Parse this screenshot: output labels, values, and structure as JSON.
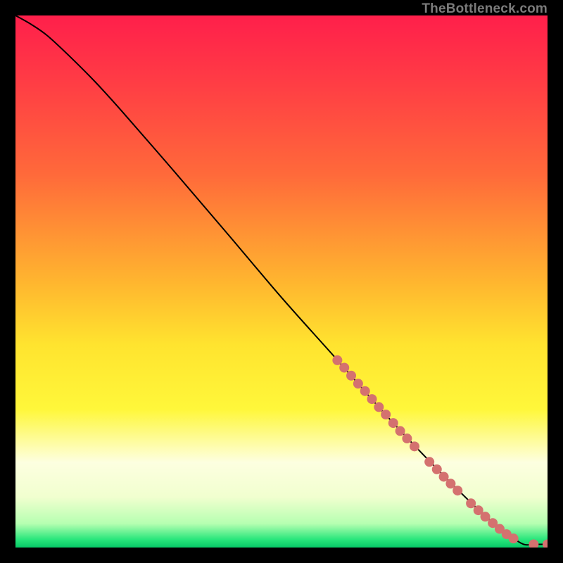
{
  "watermark": "TheBottleneck.com",
  "chart_data": {
    "type": "line",
    "title": "",
    "xlabel": "",
    "ylabel": "",
    "xlim": [
      0,
      100
    ],
    "ylim": [
      0,
      100
    ],
    "gradient_stops": [
      {
        "offset": 0.0,
        "color": "#ff1f4b"
      },
      {
        "offset": 0.12,
        "color": "#ff3b45"
      },
      {
        "offset": 0.3,
        "color": "#ff6a3a"
      },
      {
        "offset": 0.5,
        "color": "#ffb52f"
      },
      {
        "offset": 0.62,
        "color": "#ffe42f"
      },
      {
        "offset": 0.74,
        "color": "#fff73a"
      },
      {
        "offset": 0.84,
        "color": "#fdffe0"
      },
      {
        "offset": 0.905,
        "color": "#f1ffcf"
      },
      {
        "offset": 0.955,
        "color": "#b6ffb1"
      },
      {
        "offset": 0.985,
        "color": "#28e67b"
      },
      {
        "offset": 1.0,
        "color": "#07c867"
      }
    ],
    "series": [
      {
        "name": "curve",
        "points": [
          {
            "x": 0,
            "y": 100
          },
          {
            "x": 3,
            "y": 98.3
          },
          {
            "x": 6,
            "y": 96.2
          },
          {
            "x": 10,
            "y": 92.5
          },
          {
            "x": 15,
            "y": 87.5
          },
          {
            "x": 20,
            "y": 82.0
          },
          {
            "x": 30,
            "y": 70.5
          },
          {
            "x": 40,
            "y": 58.8
          },
          {
            "x": 50,
            "y": 47.0
          },
          {
            "x": 60,
            "y": 35.8
          },
          {
            "x": 70,
            "y": 24.5
          },
          {
            "x": 80,
            "y": 14.0
          },
          {
            "x": 88,
            "y": 6.2
          },
          {
            "x": 93,
            "y": 2.2
          },
          {
            "x": 95.5,
            "y": 0.6
          },
          {
            "x": 97.2,
            "y": 0.6
          },
          {
            "x": 100,
            "y": 0.6
          }
        ]
      }
    ],
    "scatter": {
      "name": "dots",
      "color": "#d4716f",
      "radius": 7,
      "points": [
        {
          "x": 60.5,
          "y": 35.2
        },
        {
          "x": 61.8,
          "y": 33.8
        },
        {
          "x": 63.1,
          "y": 32.3
        },
        {
          "x": 64.4,
          "y": 30.8
        },
        {
          "x": 65.7,
          "y": 29.4
        },
        {
          "x": 67.0,
          "y": 27.9
        },
        {
          "x": 68.3,
          "y": 26.4
        },
        {
          "x": 69.6,
          "y": 25.0
        },
        {
          "x": 71.0,
          "y": 23.4
        },
        {
          "x": 72.3,
          "y": 21.9
        },
        {
          "x": 73.6,
          "y": 20.5
        },
        {
          "x": 75.0,
          "y": 19.0
        },
        {
          "x": 77.8,
          "y": 16.1
        },
        {
          "x": 79.2,
          "y": 14.7
        },
        {
          "x": 80.5,
          "y": 13.3
        },
        {
          "x": 81.8,
          "y": 12.0
        },
        {
          "x": 83.1,
          "y": 10.7
        },
        {
          "x": 85.6,
          "y": 8.3
        },
        {
          "x": 87.0,
          "y": 7.0
        },
        {
          "x": 88.3,
          "y": 5.8
        },
        {
          "x": 89.7,
          "y": 4.6
        },
        {
          "x": 91.0,
          "y": 3.5
        },
        {
          "x": 92.3,
          "y": 2.5
        },
        {
          "x": 93.6,
          "y": 1.7
        },
        {
          "x": 97.4,
          "y": 0.6
        },
        {
          "x": 100.0,
          "y": 0.6
        }
      ]
    }
  }
}
